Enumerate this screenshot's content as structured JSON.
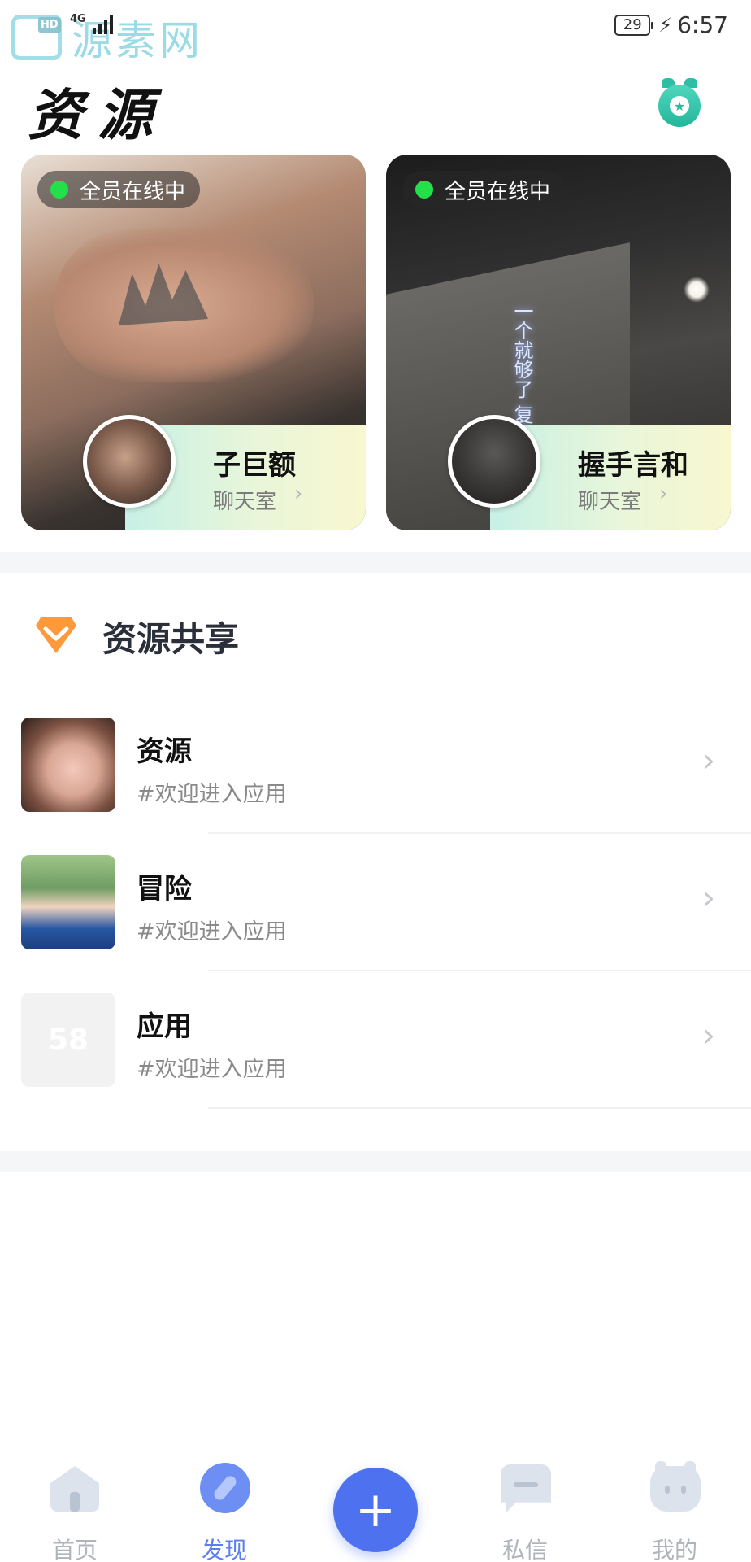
{
  "status_bar": {
    "watermark": "源素网",
    "watermark_badge": "HD",
    "network": "4G",
    "battery": "29",
    "time": "6:57"
  },
  "header": {
    "title": "资源",
    "badge_icon": "alarm-clock-star-icon"
  },
  "rooms": [
    {
      "status": "全员在线中",
      "name": "子巨额",
      "subtitle": "聊天室",
      "status_color": "#21e04a",
      "wall_text": ""
    },
    {
      "status": "全员在线中",
      "name": "握手言和",
      "subtitle": "聊天室",
      "status_color": "#21e04a",
      "wall_text": "一个就够了 复杂世界里"
    }
  ],
  "section": {
    "title": "资源共享",
    "icon": "diamond-chevron-icon",
    "accent_color": "#ff9a3c"
  },
  "items": [
    {
      "title": "资源",
      "subtitle": "#欢迎进入应用",
      "thumb_text": ""
    },
    {
      "title": "冒险",
      "subtitle": "#欢迎进入应用",
      "thumb_text": ""
    },
    {
      "title": "应用",
      "subtitle": "#欢迎进入应用",
      "thumb_text": "58"
    }
  ],
  "nav": {
    "items": [
      {
        "label": "首页",
        "icon": "home-icon"
      },
      {
        "label": "发现",
        "icon": "compass-icon",
        "active": true
      },
      {
        "label": "",
        "icon": "plus-icon"
      },
      {
        "label": "私信",
        "icon": "message-icon"
      },
      {
        "label": "我的",
        "icon": "profile-icon"
      }
    ],
    "active_color": "#5b7ef0",
    "inactive_color": "#b0b4bb"
  }
}
